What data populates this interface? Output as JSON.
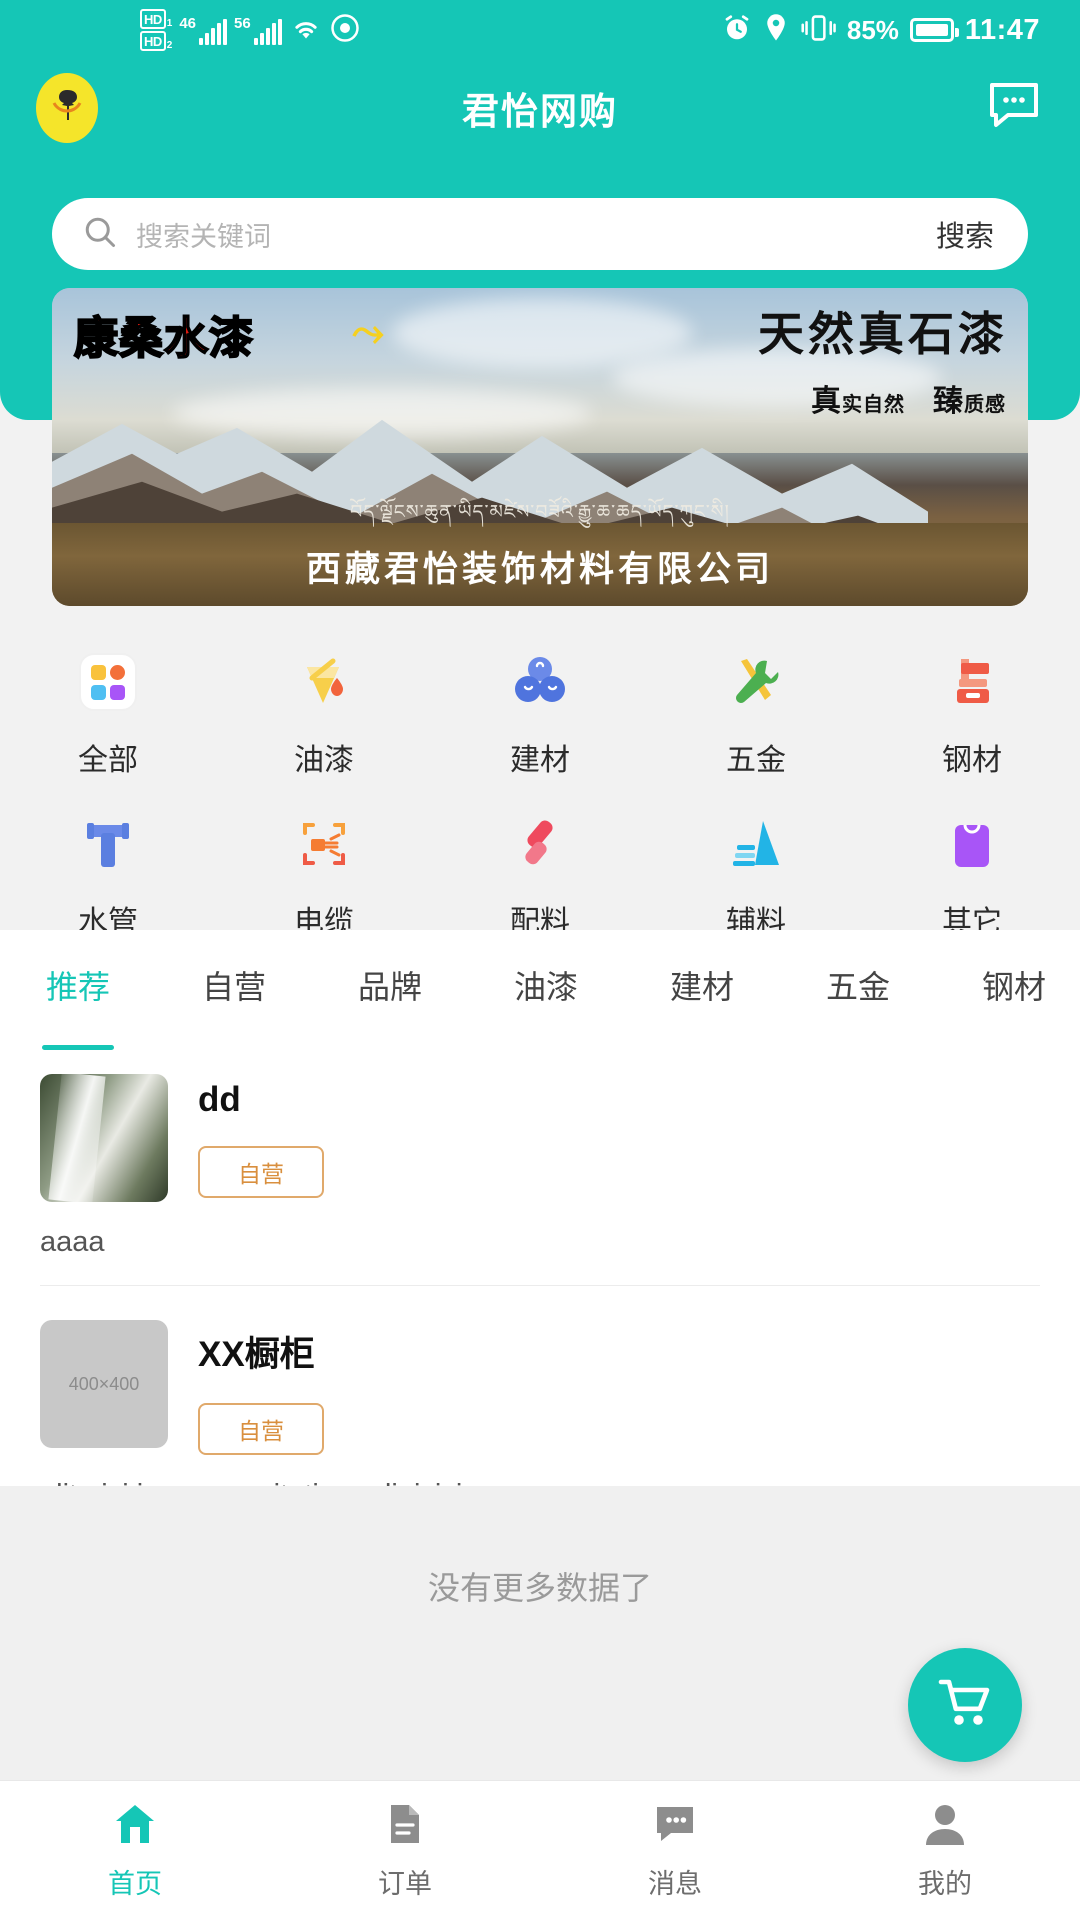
{
  "status_bar": {
    "hd1_label": "HD",
    "hd1_sub": "1",
    "hd2_label": "HD",
    "hd2_sub": "2",
    "net1": "46",
    "net2": "56",
    "wifi_icon": "wifi-icon",
    "eye_icon": "eye-icon",
    "alarm_icon": "alarm-icon",
    "location_icon": "location-icon",
    "vibrate_icon": "vibrate-icon",
    "battery_percent": "85%",
    "time": "11:47"
  },
  "header": {
    "title": "君怡网购",
    "logo_name": "brand-logo",
    "message_icon": "message-icon"
  },
  "search": {
    "placeholder": "搜索关键词",
    "button_label": "搜索",
    "icon": "search-icon"
  },
  "banner": {
    "brand_text": "康桑水漆",
    "swoosh": "⤳",
    "title": "天然真石漆",
    "subtitle_1_big": "真",
    "subtitle_1_small": "实自然",
    "subtitle_2_big": "臻",
    "subtitle_2_small": "质感",
    "tibetan": "བོད་ལྗོངས་ཆུན་ཡིད་མཛེས་བཟོའི་རྒྱུ་ཆ་ཆད་ཡོད་ཀུང་སི།",
    "company": "西藏君怡装饰材料有限公司"
  },
  "categories": {
    "row1": [
      {
        "label": "全部",
        "icon": "grid-all-icon",
        "color": "#f7b500"
      },
      {
        "label": "油漆",
        "icon": "paint-bucket-icon",
        "color": "#f5c230"
      },
      {
        "label": "建材",
        "icon": "building-material-icon",
        "color": "#5b7fe0"
      },
      {
        "label": "五金",
        "icon": "hardware-tools-icon",
        "color": "#4caf50"
      },
      {
        "label": "钢材",
        "icon": "steel-icon",
        "color": "#ef5b46"
      }
    ],
    "row2": [
      {
        "label": "水管",
        "icon": "water-pipe-icon",
        "color": "#5b7fe0"
      },
      {
        "label": "电缆",
        "icon": "cable-icon",
        "color": "#f57c32"
      },
      {
        "label": "配料",
        "icon": "parts-icon",
        "color": "#ef4a5e"
      },
      {
        "label": "辅料",
        "icon": "auxiliary-material-icon",
        "color": "#22b4e6"
      },
      {
        "label": "其它",
        "icon": "other-bag-icon",
        "color": "#a855f7"
      }
    ]
  },
  "tabs": [
    {
      "label": "推荐",
      "active": true
    },
    {
      "label": "自营",
      "active": false
    },
    {
      "label": "品牌",
      "active": false
    },
    {
      "label": "油漆",
      "active": false
    },
    {
      "label": "建材",
      "active": false
    },
    {
      "label": "五金",
      "active": false
    },
    {
      "label": "钢材",
      "active": false
    }
  ],
  "products": [
    {
      "name": "dd",
      "badge": "自营",
      "description": "aaaa",
      "thumb_kind": "photo",
      "thumb_label": ""
    },
    {
      "name": "XX橱柜",
      "badge": "自营",
      "description": "elit nisi irure exercitation adipisicing",
      "thumb_kind": "placeholder",
      "thumb_label": "400×400"
    }
  ],
  "footer": {
    "no_more": "没有更多数据了",
    "cart_icon": "shopping-cart-icon"
  },
  "bottom_nav": [
    {
      "label": "首页",
      "icon": "home-icon",
      "active": true
    },
    {
      "label": "订单",
      "icon": "order-document-icon",
      "active": false
    },
    {
      "label": "消息",
      "icon": "message-bubble-icon",
      "active": false
    },
    {
      "label": "我的",
      "icon": "person-icon",
      "active": false
    }
  ],
  "theme": {
    "accent": "#15c6b6",
    "badge_border": "#e0a96b",
    "badge_text": "#d98f3e"
  }
}
